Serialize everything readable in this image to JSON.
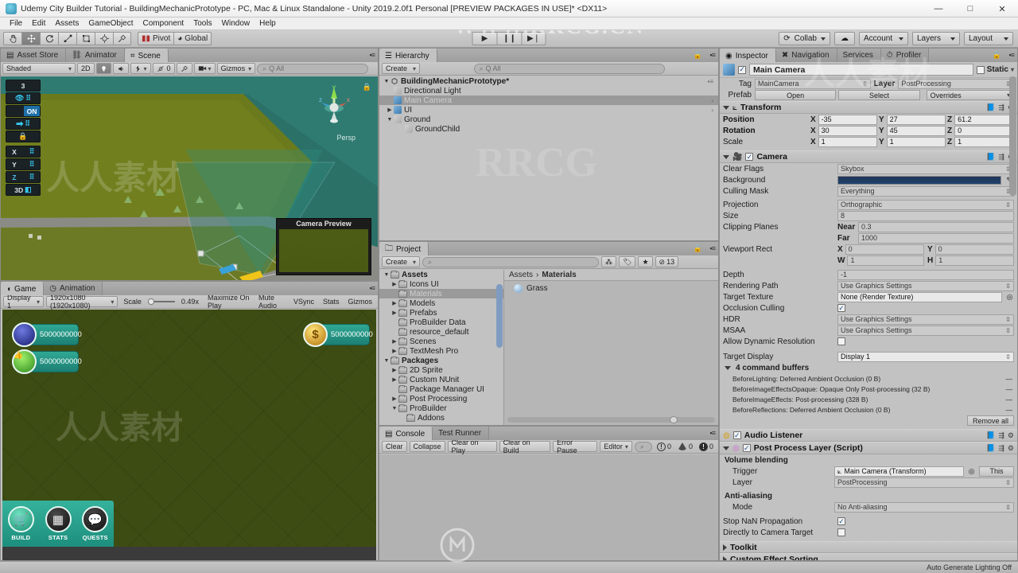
{
  "window": {
    "title": "Udemy City Builder Tutorial - BuildingMechanicPrototype - PC, Mac & Linux Standalone - Unity 2019.2.0f1 Personal [PREVIEW PACKAGES IN USE]* <DX11>",
    "minimize": "—",
    "maximize": "□",
    "close": "✕"
  },
  "menubar": [
    "File",
    "Edit",
    "Assets",
    "GameObject",
    "Component",
    "Tools",
    "Window",
    "Help"
  ],
  "toolbar": {
    "transform_tools": [
      "hand",
      "move",
      "rotate",
      "scale",
      "rect",
      "transform",
      "custom"
    ],
    "pivot": "Pivot",
    "pivot_rotation": "Global",
    "play": "▶",
    "pause": "❙❙",
    "step": "▶❘",
    "collab": "Collab",
    "cloud": "cloud-icon",
    "account": "Account",
    "layers": "Layers",
    "layout": "Layout"
  },
  "scene": {
    "tabs": [
      {
        "label": "Asset Store",
        "icon": "store-icon",
        "active": false
      },
      {
        "label": "Animator",
        "icon": "animator-icon",
        "active": false
      },
      {
        "label": "Scene",
        "icon": "grid-icon",
        "active": true
      }
    ],
    "shading": "Shaded",
    "mode_2d": "2D",
    "light_icon": "light-icon",
    "audio_icon": "audio-icon",
    "fx_icon": "fx-icon",
    "hidden_count": "0",
    "tools_icon": "tools-icon",
    "camera_icon": "camera-icon",
    "gizmos": "Gizmos",
    "search_placeholder": "Q All",
    "progrids": {
      "snap_value": "3",
      "visibility": "eye-icon",
      "on_toggle": "ON",
      "push_icon": "push-grid-icon",
      "lock_icon": "lock-grid-icon",
      "axis_x": "X",
      "axis_y": "Y",
      "axis_z": "Z",
      "perspective": "3D"
    },
    "gizmo_axes": {
      "x": "x",
      "y": "y",
      "z": "z"
    },
    "perspective_label": "Persp",
    "camera_preview_title": "Camera Preview"
  },
  "game": {
    "tabs": [
      {
        "label": "Game",
        "icon": "game-icon",
        "active": true
      },
      {
        "label": "Animation",
        "icon": "clock-icon",
        "active": false
      }
    ],
    "display": "Display 1",
    "resolution": "1920x1080 (1920x1080)",
    "scale_label": "Scale",
    "scale_value": "0.49x",
    "maximize_on_play": "Maximize On Play",
    "mute_audio": "Mute Audio",
    "vsync": "VSync",
    "stats": "Stats",
    "gizmos": "Gizmos",
    "hud": {
      "resource_population": "5000000000",
      "resource_happiness": "5000000000",
      "resource_gold": "5000000000"
    },
    "bottom_buttons": [
      {
        "label": "BUILD",
        "icon": "cart-icon"
      },
      {
        "label": "STATS",
        "icon": "calendar-icon"
      },
      {
        "label": "QUESTS",
        "icon": "chat-icon"
      }
    ]
  },
  "hierarchy": {
    "tab": "Hierarchy",
    "create": "Create",
    "search_placeholder": "Q All",
    "items": [
      {
        "label": "BuildingMechanicPrototype*",
        "depth": 0,
        "icon": "scene-icon",
        "expanded": true,
        "bold": true,
        "selected": false,
        "arrow": false
      },
      {
        "label": "Directional Light",
        "depth": 1,
        "icon": "light-object-icon",
        "expanded": null,
        "bold": false,
        "selected": false,
        "arrow": false
      },
      {
        "label": "Main Camera",
        "depth": 1,
        "icon": "prefab-icon",
        "expanded": null,
        "bold": false,
        "selected": true,
        "arrow": true
      },
      {
        "label": "UI",
        "depth": 1,
        "icon": "prefab-icon",
        "expanded": false,
        "bold": false,
        "selected": false,
        "arrow": true
      },
      {
        "label": "Ground",
        "depth": 1,
        "icon": "object-icon",
        "expanded": true,
        "bold": false,
        "selected": false,
        "arrow": false
      },
      {
        "label": "GroundChild",
        "depth": 2,
        "icon": "object-icon",
        "expanded": null,
        "bold": false,
        "selected": false,
        "arrow": false
      }
    ]
  },
  "project": {
    "tab": "Project",
    "create": "Create",
    "search_placeholder": "",
    "icon_count": "13",
    "breadcrumb": [
      "Assets",
      "Materials"
    ],
    "tree": [
      {
        "label": "Assets",
        "depth": 0,
        "expanded": true,
        "bold": true,
        "selected": false
      },
      {
        "label": "Icons UI",
        "depth": 1,
        "expanded": false,
        "bold": false,
        "selected": false
      },
      {
        "label": "Materials",
        "depth": 1,
        "expanded": null,
        "bold": false,
        "selected": true
      },
      {
        "label": "Models",
        "depth": 1,
        "expanded": false,
        "bold": false,
        "selected": false
      },
      {
        "label": "Prefabs",
        "depth": 1,
        "expanded": false,
        "bold": false,
        "selected": false
      },
      {
        "label": "ProBuilder Data",
        "depth": 1,
        "expanded": null,
        "bold": false,
        "selected": false
      },
      {
        "label": "resource_default",
        "depth": 1,
        "expanded": null,
        "bold": false,
        "selected": false
      },
      {
        "label": "Scenes",
        "depth": 1,
        "expanded": false,
        "bold": false,
        "selected": false
      },
      {
        "label": "TextMesh Pro",
        "depth": 1,
        "expanded": false,
        "bold": false,
        "selected": false
      },
      {
        "label": "Packages",
        "depth": 0,
        "expanded": true,
        "bold": true,
        "selected": false
      },
      {
        "label": "2D Sprite",
        "depth": 1,
        "expanded": false,
        "bold": false,
        "selected": false
      },
      {
        "label": "Custom NUnit",
        "depth": 1,
        "expanded": false,
        "bold": false,
        "selected": false
      },
      {
        "label": "Package Manager UI",
        "depth": 1,
        "expanded": null,
        "bold": false,
        "selected": false
      },
      {
        "label": "Post Processing",
        "depth": 1,
        "expanded": false,
        "bold": false,
        "selected": false
      },
      {
        "label": "ProBuilder",
        "depth": 1,
        "expanded": true,
        "bold": false,
        "selected": false
      },
      {
        "label": "Addons",
        "depth": 2,
        "expanded": null,
        "bold": false,
        "selected": false
      }
    ],
    "assets": [
      {
        "label": "Grass",
        "icon": "material-sphere-icon"
      }
    ]
  },
  "console": {
    "tabs": [
      {
        "label": "Console",
        "icon": "console-icon",
        "active": true
      },
      {
        "label": "Test Runner",
        "icon": "",
        "active": false
      }
    ],
    "clear": "Clear",
    "collapse": "Collapse",
    "clear_on_play": "Clear on Play",
    "clear_on_build": "Clear on Build",
    "error_pause": "Error Pause",
    "editor": "Editor",
    "search_placeholder": "",
    "info_count": "0",
    "warning_count": "0",
    "error_count": "0"
  },
  "inspector": {
    "tabs": [
      {
        "label": "Inspector",
        "icon": "inspector-icon",
        "active": true
      },
      {
        "label": "Navigation",
        "icon": "navigation-icon",
        "active": false
      },
      {
        "label": "Services",
        "icon": "services-icon",
        "active": false
      },
      {
        "label": "Profiler",
        "icon": "profiler-icon",
        "active": false
      }
    ],
    "object_name": "Main Camera",
    "enabled": true,
    "static_label": "Static",
    "tag_label": "Tag",
    "tag_value": "MainCamera",
    "layer_label": "Layer",
    "layer_value": "PostProcessing",
    "prefab_label": "Prefab",
    "prefab_open": "Open",
    "prefab_select": "Select",
    "prefab_overrides": "Overrides",
    "transform": {
      "title": "Transform",
      "position": {
        "label": "Position",
        "x": "-35",
        "y": "27",
        "z": "61.2"
      },
      "rotation": {
        "label": "Rotation",
        "x": "30",
        "y": "45",
        "z": "0"
      },
      "scale": {
        "label": "Scale",
        "x": "1",
        "y": "1",
        "z": "1"
      }
    },
    "camera": {
      "title": "Camera",
      "enabled": true,
      "clear_flags": {
        "label": "Clear Flags",
        "value": "Skybox"
      },
      "background": {
        "label": "Background",
        "color": "#1d3557"
      },
      "culling_mask": {
        "label": "Culling Mask",
        "value": "Everything"
      },
      "projection": {
        "label": "Projection",
        "value": "Orthographic"
      },
      "size": {
        "label": "Size",
        "value": "8"
      },
      "clipping_planes": {
        "label": "Clipping Planes",
        "near_label": "Near",
        "near": "0.3",
        "far_label": "Far",
        "far": "1000"
      },
      "viewport_rect": {
        "label": "Viewport Rect",
        "x": "0",
        "y": "0",
        "w": "1",
        "h": "1"
      },
      "depth": {
        "label": "Depth",
        "value": "-1"
      },
      "rendering_path": {
        "label": "Rendering Path",
        "value": "Use Graphics Settings"
      },
      "target_texture": {
        "label": "Target Texture",
        "value": "None (Render Texture)"
      },
      "occlusion_culling": {
        "label": "Occlusion Culling",
        "checked": true
      },
      "hdr": {
        "label": "HDR",
        "value": "Use Graphics Settings"
      },
      "msaa": {
        "label": "MSAA",
        "value": "Use Graphics Settings"
      },
      "allow_dynamic_resolution": {
        "label": "Allow Dynamic Resolution",
        "checked": false
      },
      "target_display": {
        "label": "Target Display",
        "value": "Display 1"
      },
      "command_buffers_title": "4 command buffers",
      "command_buffers": [
        "BeforeLighting: Deferred Ambient Occlusion (0 B)",
        "BeforeImageEffectsOpaque: Opaque Only Post-processing (32 B)",
        "BeforeImageEffects: Post-processing (328 B)",
        "BeforeReflections: Deferred Ambient Occlusion (0 B)"
      ],
      "remove_all": "Remove all"
    },
    "audio_listener": {
      "title": "Audio Listener",
      "enabled": true
    },
    "post_process_layer": {
      "title": "Post Process Layer (Script)",
      "enabled": true,
      "volume_blending": "Volume blending",
      "trigger": {
        "label": "Trigger",
        "value": "Main Camera (Transform)",
        "button": "This"
      },
      "layer": {
        "label": "Layer",
        "value": "PostProcessing"
      },
      "anti_aliasing": "Anti-aliasing",
      "mode": {
        "label": "Mode",
        "value": "No Anti-aliasing"
      },
      "stop_nan": {
        "label": "Stop NaN Propagation",
        "checked": true
      },
      "directly_to_camera": {
        "label": "Directly to Camera Target",
        "checked": false
      },
      "toolkit": "Toolkit",
      "custom_effect_sorting": "Custom Effect Sorting"
    }
  },
  "statusbar": {
    "text": "Auto Generate Lighting Off"
  },
  "watermarks": {
    "top": "WWW.RRCG.CN",
    "center_left": "人人素材",
    "center_right": "人人素材",
    "bottom": "人人素材",
    "rrcg": "RRCG"
  }
}
